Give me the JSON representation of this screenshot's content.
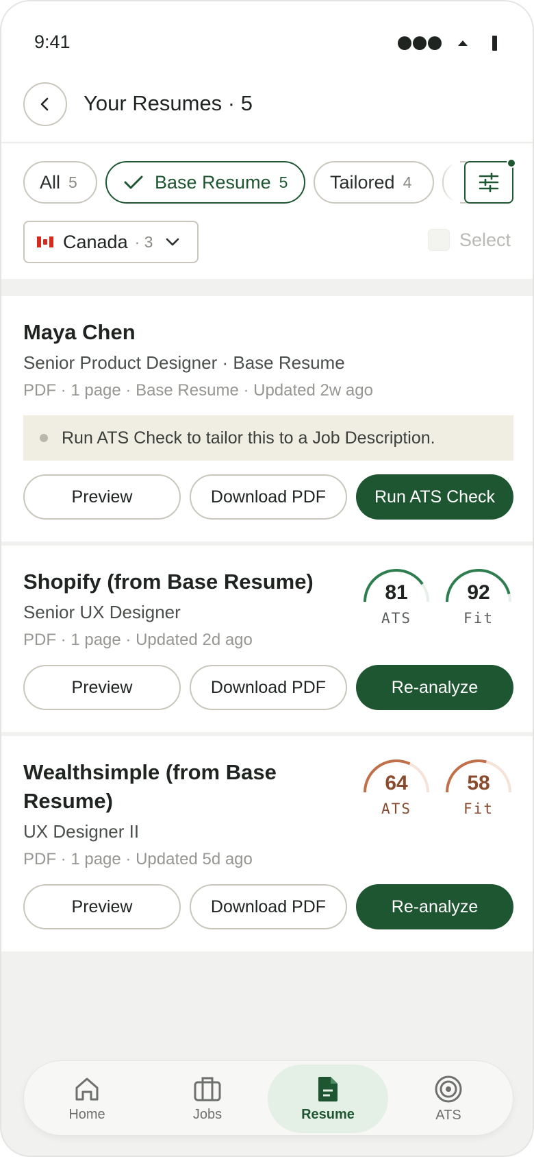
{
  "status_bar": {
    "time": "9:41"
  },
  "header": {
    "title": "Your Resumes · 5"
  },
  "filters": {
    "chips": [
      {
        "label": "All",
        "count": "5",
        "active": false
      },
      {
        "label": "Base Resume",
        "count": "5",
        "active": true
      },
      {
        "label": "Tailored",
        "count": "4",
        "active": false
      }
    ],
    "country": {
      "label": "Canada",
      "count": "· 3"
    },
    "select_label": "Select"
  },
  "resumes": [
    {
      "name": "Maya Chen",
      "role": "Senior Product Designer · Base Resume",
      "meta": "PDF · 1 page · Base Resume · Updated 2w ago",
      "notice": "Run ATS Check to tailor this to a Job Description.",
      "buttons": {
        "preview": "Preview",
        "download": "Download PDF",
        "primary": "Run ATS Check"
      }
    },
    {
      "name": "Shopify (from Base Resume)",
      "role": "Senior UX Designer",
      "meta": "PDF · 1 page · Updated 2d ago",
      "scores": [
        {
          "value": "81",
          "label": "ATS"
        },
        {
          "value": "92",
          "label": "Fit"
        }
      ],
      "buttons": {
        "preview": "Preview",
        "download": "Download PDF",
        "primary": "Re-analyze"
      }
    },
    {
      "name_line1": "Wealthsimple (from Base",
      "name_line2": "Resume)",
      "role": "UX Designer II",
      "meta": "PDF · 1 page · Updated 5d ago",
      "scores": [
        {
          "value": "64",
          "label": "ATS"
        },
        {
          "value": "58",
          "label": "Fit"
        }
      ],
      "buttons": {
        "preview": "Preview",
        "download": "Download PDF",
        "primary": "Re-analyze"
      }
    }
  ],
  "nav": [
    {
      "label": "Home",
      "icon": "home-icon"
    },
    {
      "label": "Jobs",
      "icon": "briefcase-icon"
    },
    {
      "label": "Resume",
      "icon": "document-icon",
      "active": true
    },
    {
      "label": "ATS",
      "icon": "target-icon"
    }
  ],
  "colors": {
    "accent": "#1e5631",
    "good_gauge": "#2e7d4f",
    "warn_gauge": "#c0714c",
    "warn_text": "#8a4a2e"
  }
}
